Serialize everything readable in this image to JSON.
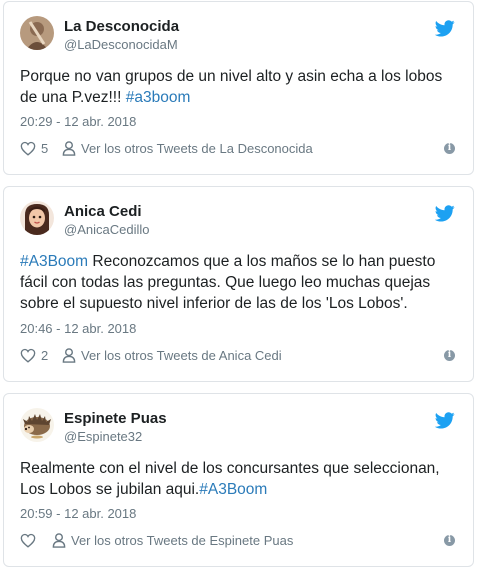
{
  "tweets": [
    {
      "name": "La Desconocida",
      "handle": "@LaDesconocidaM",
      "text_plain": "Porque no van grupos de un nivel alto y asin echa a los lobos de una P.vez!!! ",
      "hashtag": "#a3boom",
      "time": "20:29 - 12 abr. 2018",
      "likes": "5",
      "others": "Ver los otros Tweets de La Desconocida"
    },
    {
      "name": "Anica Cedi",
      "handle": "@AnicaCedillo",
      "hashtag": "#A3Boom",
      "text_plain": " Reconozcamos que a los maños se lo han puesto fácil con todas las preguntas. Que luego leo muchas quejas sobre el supuesto nivel inferior de las de los 'Los Lobos'.",
      "time": "20:46 - 12 abr. 2018",
      "likes": "2",
      "others": "Ver los otros Tweets de Anica Cedi"
    },
    {
      "name": "Espinete Puas",
      "handle": "@Espinete32",
      "text_plain": "Realmente con el nivel de los concursantes que seleccionan, Los Lobos se jubilan aqui.",
      "hashtag": "#A3Boom",
      "time": "20:59 - 12 abr. 2018",
      "likes": "",
      "others": "Ver los otros Tweets de Espinete Puas"
    }
  ],
  "icons": {
    "brand": "twitter-bird-icon",
    "like": "heart-icon",
    "profile": "person-icon",
    "info": "info-icon"
  },
  "colors": {
    "twitter_blue": "#1da1f2",
    "hashtag": "#2b7bb9",
    "muted": "#697882",
    "border": "#dfe3e7"
  }
}
